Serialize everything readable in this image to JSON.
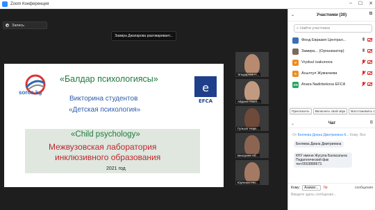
{
  "window": {
    "title": "Zoom Конференция"
  },
  "toolbar": {
    "record_label": "Запись",
    "speaking_banner": "Замира Джапарова разговаривает..."
  },
  "slide": {
    "logo_text": "soros.kg",
    "title": "«Балдар психологиясы»",
    "subtitle1": "Викторина студентов",
    "subtitle2": "«Детская психология»",
    "efca_logo_text": "EFCA",
    "box_line1": "«Child psychology»",
    "box_line2": "Межвузовская лаборатория",
    "box_line3": "инклюзивного образования",
    "year": "2021 год"
  },
  "videos": [
    {
      "name": "Эльдарова Н..."
    },
    {
      "name": "Айдана Асыл..."
    },
    {
      "name": "Гульзат Нарк..."
    },
    {
      "name": "Венгриня Аб..."
    },
    {
      "name": "Юрченко Ни..."
    }
  ],
  "participants_panel": {
    "title": "Участники (30)",
    "search_placeholder": "Найти участника",
    "participants": [
      {
        "initials": "",
        "name": "Фонд Евразия Централ...",
        "color": "#3a6fb5"
      },
      {
        "initials": "",
        "name": "Замира... (Организатор)",
        "color": "#7a6a5a"
      },
      {
        "initials": "V",
        "name": "Vryduul isakunova",
        "color": "#f08c1e"
      },
      {
        "initials": "А",
        "name": "Асылгул Жумагаева",
        "color": "#f08c1e"
      },
      {
        "initials": "AN",
        "name": "Anara Nadirbekova EFCA",
        "color": "#22a85a"
      }
    ],
    "buttons": [
      "Пригласить",
      "Включить свой звук",
      "Восстановить статус"
    ]
  },
  "chat_panel": {
    "title": "Чат",
    "from_label": "От",
    "sender": "Беляева Диана Дмитриевна К...",
    "to_label": "Кому: Все",
    "messages": [
      "Беляева Диана Дмитриевна",
      "КНУ имени Жусупа Баласагына Педагогический фак тел:0553888673."
    ],
    "to_prefix": "Кому:",
    "to_select": "Азамат...",
    "private_label": "Ли",
    "more_label": "сообщения",
    "input_placeholder": "Введите здесь сообщение..."
  }
}
